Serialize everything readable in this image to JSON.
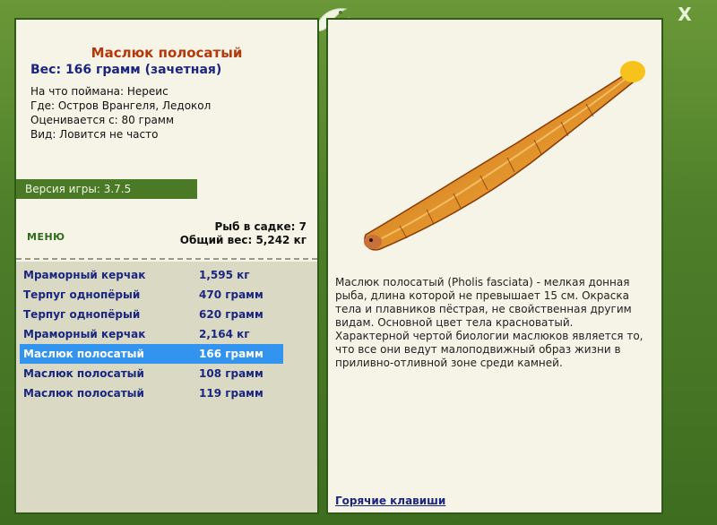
{
  "window": {
    "close_label": "X"
  },
  "fish": {
    "name": "Маслюк полосатый",
    "weight": "Вес: 166 грамм (зачетная)",
    "bait": "На что поймана: Нереис",
    "location": "Где: Остров Врангеля, Ледокол",
    "rated_from": "Оценивается с: 80 грамм",
    "kind": "Вид: Ловится не часто"
  },
  "version": "Версия игры: 3.7.5",
  "menu_label": "МЕНЮ",
  "stats": {
    "fish_count": "Рыб в садке: 7",
    "total_weight": "Общий вес: 5,242 кг"
  },
  "catch_list": [
    {
      "name": "Мраморный керчак",
      "weight": "1,595 кг"
    },
    {
      "name": "Терпуг однопёрый",
      "weight": "470 грамм"
    },
    {
      "name": "Терпуг однопёрый",
      "weight": "620 грамм"
    },
    {
      "name": "Мраморный керчак",
      "weight": "2,164 кг"
    },
    {
      "name": "Маслюк полосатый",
      "weight": "166 грамм"
    },
    {
      "name": "Маслюк полосатый",
      "weight": "108 грамм"
    },
    {
      "name": "Маслюк полосатый",
      "weight": "119 грамм"
    }
  ],
  "selected_index": 4,
  "description": [
    "Маслюк полосатый (Pholis fasciata) - мелкая донная",
    "рыба, длина которой не превышает 15 см. Окраска",
    "тела и плавников пёстрая, не свойственная другим",
    "видам. Основной цвет тела красноватый.",
    "Характерной чертой биологии маслюков является то,",
    "что все они ведут малоподвижный образ жизни в",
    "приливно-отливной зоне среди камней."
  ],
  "hotkeys_label": "Горячие клавиши",
  "icons": {
    "close": "close-icon",
    "ornament": "fish-ornament-icon"
  }
}
